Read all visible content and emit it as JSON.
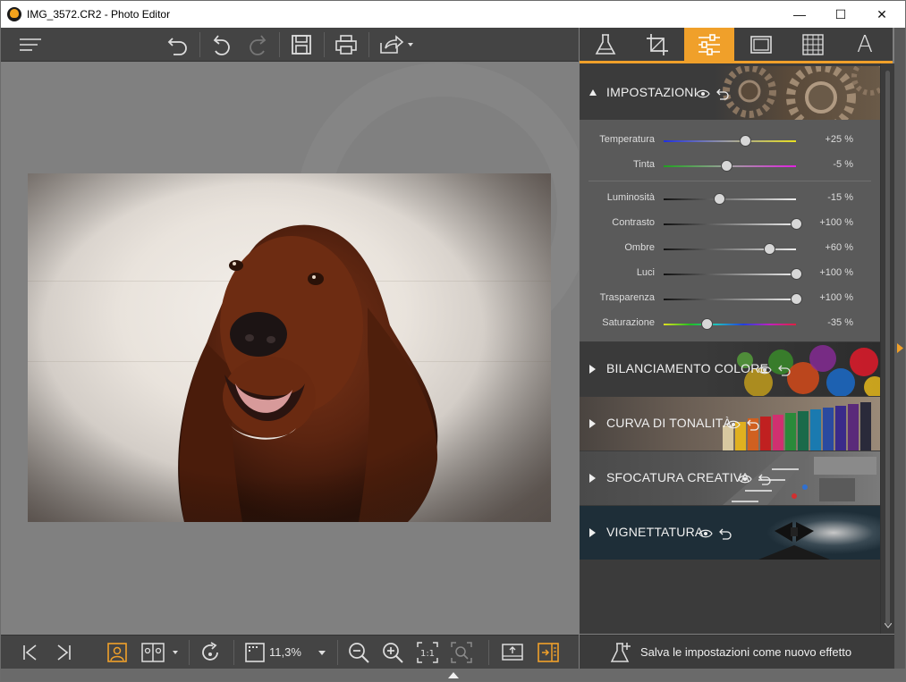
{
  "window": {
    "title": "IMG_3572.CR2 - Photo Editor",
    "minimize_glyph": "—",
    "maximize_glyph": "☐",
    "close_glyph": "✕"
  },
  "toolbar": {
    "icons": [
      "menu-icon",
      "undo-all-icon",
      "undo-icon",
      "redo-icon",
      "save-icon",
      "print-icon",
      "share-icon"
    ]
  },
  "right_tabs": {
    "icons": [
      "flask-icon",
      "crop-icon",
      "sliders-icon",
      "frame-icon",
      "texture-icon",
      "text-icon"
    ],
    "active_index": 2,
    "text_tab_glyph": "A"
  },
  "panel": {
    "sections": [
      {
        "label": "IMPOSTAZIONI",
        "expanded": true
      },
      {
        "label": "BILANCIAMENTO COLORE",
        "expanded": false
      },
      {
        "label": "CURVA DI TONALITÀ",
        "expanded": false
      },
      {
        "label": "SFOCATURA CREATIVA",
        "expanded": false
      },
      {
        "label": "VIGNETTATURA",
        "expanded": false
      }
    ],
    "sliders": [
      {
        "label": "Temperatura",
        "value": "+25 %",
        "level": 0.62,
        "track": "temperature"
      },
      {
        "label": "Tinta",
        "value": "-5 %",
        "level": 0.475,
        "track": "tint"
      },
      {
        "label": "Luminosità",
        "value": "-15 %",
        "level": 0.425,
        "track": "gray"
      },
      {
        "label": "Contrasto",
        "value": "+100 %",
        "level": 1.0,
        "track": "gray"
      },
      {
        "label": "Ombre",
        "value": "+60 %",
        "level": 0.8,
        "track": "gray"
      },
      {
        "label": "Luci",
        "value": "+100 %",
        "level": 1.0,
        "track": "gray"
      },
      {
        "label": "Trasparenza",
        "value": "+100 %",
        "level": 1.0,
        "track": "gray"
      },
      {
        "label": "Saturazione",
        "value": "-35 %",
        "level": 0.325,
        "track": "rainbow"
      }
    ],
    "save_effect_label": "Salva le impostazioni come nuovo effetto"
  },
  "bottombar": {
    "zoom": "11,3%",
    "icons": [
      "first-image-icon",
      "last-image-icon",
      "single-view-icon",
      "compare-view-icon",
      "rotate-icon",
      "fit-icon",
      "zoom-out-icon",
      "zoom-in-icon",
      "actual-size-icon",
      "fit-selection-icon",
      "export-icon",
      "panel-toggle-icon"
    ]
  },
  "colors": {
    "accent": "#f0a02a",
    "panel_bg": "#3b3b3b",
    "slider_bg": "#5a5a5a",
    "toolbar_bg": "#444444",
    "canvas_bg": "#808080"
  }
}
